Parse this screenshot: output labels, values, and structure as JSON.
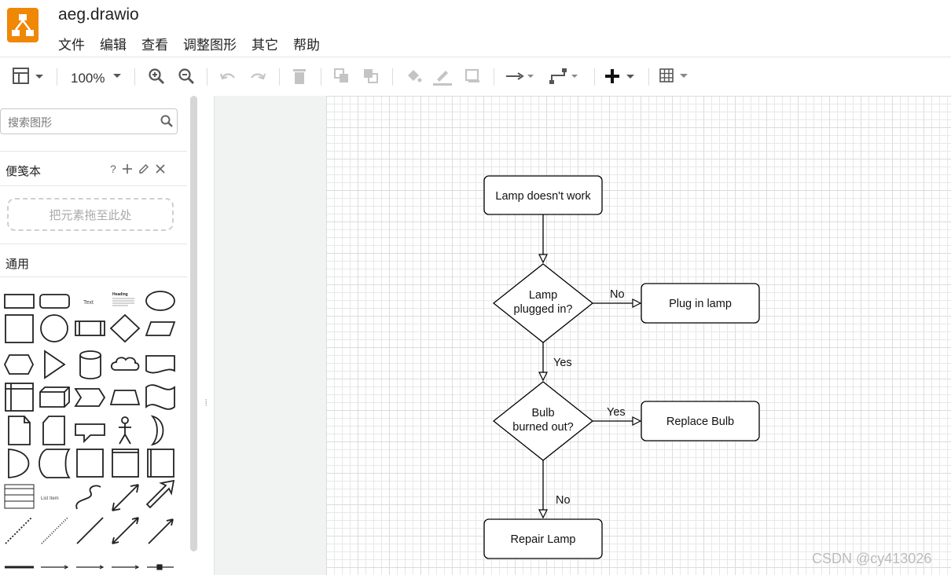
{
  "app": {
    "title": "aeg.drawio"
  },
  "menu": [
    "文件",
    "编辑",
    "查看",
    "调整图形",
    "其它",
    "帮助"
  ],
  "toolbar": {
    "zoom": "100%"
  },
  "sidebar": {
    "search_placeholder": "搜索图形",
    "scratchpad_title": "便笺本",
    "scratchpad_help": "?",
    "drop_hint": "把元素拖至此处",
    "general_title": "通用",
    "shape_labels": {
      "text": "Text",
      "heading": "Heading",
      "list_item": "List Item"
    }
  },
  "diagram": {
    "nodes": {
      "start": "Lamp doesn't work",
      "q1_line1": "Lamp",
      "q1_line2": "plugged in?",
      "plug": "Plug in lamp",
      "q2_line1": "Bulb",
      "q2_line2": "burned out?",
      "replace": "Replace Bulb",
      "repair": "Repair Lamp"
    },
    "edges": {
      "q1_no": "No",
      "q1_yes": "Yes",
      "q2_yes": "Yes",
      "q2_no": "No"
    }
  },
  "watermark": "CSDN @cy413026"
}
